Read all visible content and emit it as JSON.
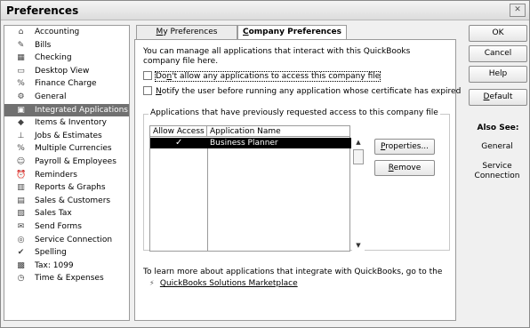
{
  "window": {
    "title": "Preferences"
  },
  "sidebar": {
    "items": [
      {
        "label": "Accounting",
        "icon": "accounting-icon",
        "glyph": "⌂",
        "selected": false
      },
      {
        "label": "Bills",
        "icon": "bills-icon",
        "glyph": "✎",
        "selected": false
      },
      {
        "label": "Checking",
        "icon": "checking-icon",
        "glyph": "▦",
        "selected": false
      },
      {
        "label": "Desktop View",
        "icon": "desktop-view-icon",
        "glyph": "▭",
        "selected": false
      },
      {
        "label": "Finance Charge",
        "icon": "finance-charge-icon",
        "glyph": "%",
        "selected": false
      },
      {
        "label": "General",
        "icon": "general-icon",
        "glyph": "⚙",
        "selected": false
      },
      {
        "label": "Integrated Applications",
        "icon": "integrated-applications-icon",
        "glyph": "▣",
        "selected": true
      },
      {
        "label": "Items & Inventory",
        "icon": "items-inventory-icon",
        "glyph": "◆",
        "selected": false
      },
      {
        "label": "Jobs & Estimates",
        "icon": "jobs-estimates-icon",
        "glyph": "⊥",
        "selected": false
      },
      {
        "label": "Multiple Currencies",
        "icon": "multiple-currencies-icon",
        "glyph": "%",
        "selected": false
      },
      {
        "label": "Payroll & Employees",
        "icon": "payroll-employees-icon",
        "glyph": "☺",
        "selected": false
      },
      {
        "label": "Reminders",
        "icon": "reminders-icon",
        "glyph": "⏰",
        "selected": false
      },
      {
        "label": "Reports & Graphs",
        "icon": "reports-graphs-icon",
        "glyph": "▥",
        "selected": false
      },
      {
        "label": "Sales & Customers",
        "icon": "sales-customers-icon",
        "glyph": "▤",
        "selected": false
      },
      {
        "label": "Sales Tax",
        "icon": "sales-tax-icon",
        "glyph": "▧",
        "selected": false
      },
      {
        "label": "Send Forms",
        "icon": "send-forms-icon",
        "glyph": "✉",
        "selected": false
      },
      {
        "label": "Service Connection",
        "icon": "service-connection-icon",
        "glyph": "◎",
        "selected": false
      },
      {
        "label": "Spelling",
        "icon": "spelling-icon",
        "glyph": "✔",
        "selected": false
      },
      {
        "label": "Tax: 1099",
        "icon": "tax-1099-icon",
        "glyph": "▩",
        "selected": false
      },
      {
        "label": "Time & Expenses",
        "icon": "time-expenses-icon",
        "glyph": "◷",
        "selected": false
      }
    ]
  },
  "tabs": {
    "my_prefix": "M",
    "my_rest": "y Preferences",
    "company_prefix": "C",
    "company_rest": "ompany Preferences"
  },
  "panel": {
    "intro": "You can manage all applications that interact with this QuickBooks company file here.",
    "checkbox1_prefix": "Do",
    "checkbox1_key": "n",
    "checkbox1_rest": "'t allow any applications to access this company file",
    "checkbox2_key": "N",
    "checkbox2_rest": "otify the user before running any application whose certificate has expired",
    "legend": "Applications that have previously requested access to this company file",
    "grid": {
      "col_allow": "Allow Access",
      "col_name": "Application Name",
      "rows": [
        {
          "allowed": "✓",
          "name": "Business Planner"
        }
      ]
    },
    "properties_key": "P",
    "properties_rest": "roperties...",
    "remove_key": "R",
    "remove_rest": "emove",
    "footer": "To learn more about applications that integrate with QuickBooks, go to the",
    "link": "QuickBooks Solutions Marketplace"
  },
  "buttons": {
    "ok": "OK",
    "cancel": "Cancel",
    "help": "Help",
    "default_key": "D",
    "default_rest": "efault"
  },
  "also_see": {
    "heading": "Also See:",
    "general": "General",
    "service_line1": "Service",
    "service_line2": "Connection"
  }
}
